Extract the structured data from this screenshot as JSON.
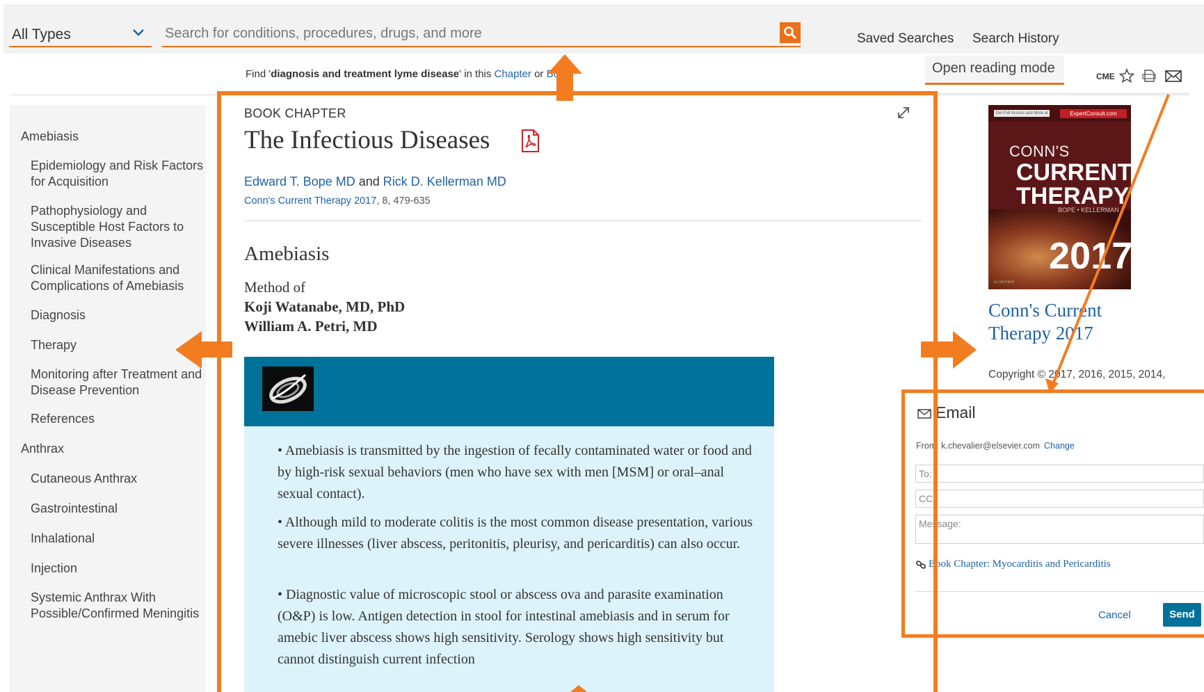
{
  "search": {
    "type_label": "All Types",
    "placeholder": "Search for conditions, procedures, drugs, and more"
  },
  "top_links": {
    "saved_searches": "Saved Searches",
    "search_history": "Search History"
  },
  "find_bar": {
    "prefix": "Find '",
    "query": "diagnosis and treatment lyme disease",
    "middle": "' in this ",
    "chapter_link": "Chapter",
    "or": " or ",
    "book_link": "Book"
  },
  "sidebar": {
    "items": [
      {
        "label": "Amebiasis",
        "level": "top"
      },
      {
        "label": "Epidemiology and Risk Factors for Acquisition",
        "level": "sub"
      },
      {
        "label": "Pathophysiology and Susceptible Host Factors to Invasive Diseases",
        "level": "sub"
      },
      {
        "label": "Clinical Manifestations and Complications of Amebiasis",
        "level": "sub"
      },
      {
        "label": "Diagnosis",
        "level": "sub"
      },
      {
        "label": "Therapy",
        "level": "sub"
      },
      {
        "label": "Monitoring after Treatment and Disease Prevention",
        "level": "sub"
      },
      {
        "label": "References",
        "level": "sub"
      },
      {
        "label": "Anthrax",
        "level": "top"
      },
      {
        "label": "Cutaneous Anthrax",
        "level": "sub"
      },
      {
        "label": "Gastrointestinal",
        "level": "sub"
      },
      {
        "label": "Inhalational",
        "level": "sub"
      },
      {
        "label": "Injection",
        "level": "sub"
      },
      {
        "label": "Systemic Anthrax With Possible/Confirmed Meningitis",
        "level": "sub"
      }
    ]
  },
  "article": {
    "eyebrow": "BOOK CHAPTER",
    "title": "The Infectious Diseases",
    "author1": "Edward T. Bope MD",
    "and": " and ",
    "author2": "Rick D. Kellerman MD",
    "source_link": "Conn's Current Therapy 2017",
    "source_rest": ", 8, 479-635",
    "section": "Amebiasis",
    "method_of": "Method of",
    "method_author1": "Koji Watanabe, MD, PhD",
    "method_author2": "William A. Petri, MD",
    "bullets": [
      "• Amebiasis is transmitted by the ingestion of fecally contaminated water or food and by high-risk sexual behaviors (men who have sex with men [MSM] or oral–anal sexual contact).",
      "• Although mild to moderate colitis is the most common disease presentation, various severe illnesses (liver abscess, peritonitis, pleurisy, and pericarditis) can also occur.",
      "• Diagnostic value of microscopic stool or abscess ova and parasite examination (O&P) is low. Antigen detection in stool for intestinal amebiasis and in serum for amebic liver abscess shows high sensitivity. Serology shows high sensitivity but cannot distinguish current infection"
    ]
  },
  "right": {
    "open_reading": "Open reading mode",
    "cme": "CME",
    "book_title": "Conn's Current Therapy 2017",
    "copyright": "Copyright © 2017, 2016, 2015, 2014,"
  },
  "cover": {
    "badge_left": "Get Full Access and More at",
    "badge_right": "ExpertConsult.com",
    "conns": "CONN'S",
    "current": "CURRENT",
    "therapy": "THERAPY",
    "editors": "BOPE • KELLERMAN",
    "year": "2017",
    "publisher": "ELSEVIER"
  },
  "email": {
    "header": "Email",
    "from": "From: k.chevalier@elsevier.com",
    "change": "Change",
    "to_placeholder": "To:",
    "cc_placeholder": "CC:",
    "message_placeholder": "Message:",
    "link": "Book Chapter: Myocarditis and Pericarditis",
    "cancel": "Cancel",
    "send": "Send"
  },
  "colors": {
    "accent_orange": "#e9711c",
    "annotation_orange": "#f47c20",
    "link_blue": "#1e62a6",
    "keypoint_teal": "#00729a",
    "keypoint_bg": "#dcf3fb"
  }
}
